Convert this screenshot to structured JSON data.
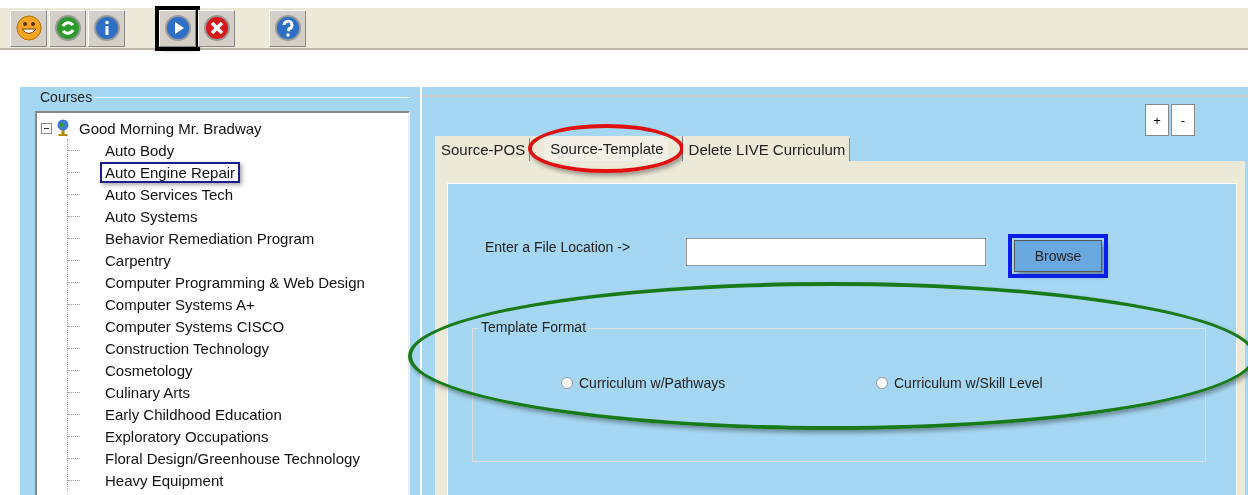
{
  "toolbar": {
    "groups": [
      [
        {
          "boxed": false
        },
        {
          "boxed": false
        },
        {
          "boxed": false
        }
      ],
      [
        {
          "boxed": true
        },
        {
          "boxed": false
        }
      ],
      [
        {
          "boxed": false
        }
      ]
    ]
  },
  "courses": {
    "title": "Courses",
    "root": {
      "label": "Good Morning Mr. Bradway",
      "expanded": true,
      "children": [
        {
          "label": "Auto Body",
          "boxed": false
        },
        {
          "label": "Auto Engine Repair",
          "boxed": true
        },
        {
          "label": "Auto Services Tech",
          "boxed": false
        },
        {
          "label": "Auto Systems",
          "boxed": false
        },
        {
          "label": "Behavior Remediation Program",
          "boxed": false
        },
        {
          "label": "Carpentry",
          "boxed": false
        },
        {
          "label": "Computer Programming & Web Design",
          "boxed": false
        },
        {
          "label": "Computer Systems A+",
          "boxed": false
        },
        {
          "label": "Computer Systems CISCO",
          "boxed": false
        },
        {
          "label": "Construction Technology",
          "boxed": false
        },
        {
          "label": "Cosmetology",
          "boxed": false
        },
        {
          "label": "Culinary Arts",
          "boxed": false
        },
        {
          "label": "Early Childhood Education",
          "boxed": false
        },
        {
          "label": "Exploratory Occupations",
          "boxed": false
        },
        {
          "label": "Floral Design/Greenhouse Technology",
          "boxed": false
        },
        {
          "label": "Heavy Equipment",
          "boxed": false
        }
      ]
    }
  },
  "zoom_buttons": [
    "+",
    "-"
  ],
  "tabs": [
    {
      "label": "Source-POS",
      "selected": false,
      "circled": false
    },
    {
      "label": "Source-Template",
      "selected": true,
      "circled": true
    },
    {
      "label": "Delete LIVE Curriculum",
      "selected": false,
      "circled": false
    }
  ],
  "file_location": {
    "label": "Enter a File Location ->",
    "button": "Browse",
    "button_boxed": true
  },
  "template_format": {
    "title": "Template Format",
    "circled": true,
    "options": [
      {
        "label": "Curriculum w/Pathways",
        "selected": false
      },
      {
        "label": "Curriculum w/Skill Level",
        "selected": false
      }
    ]
  }
}
